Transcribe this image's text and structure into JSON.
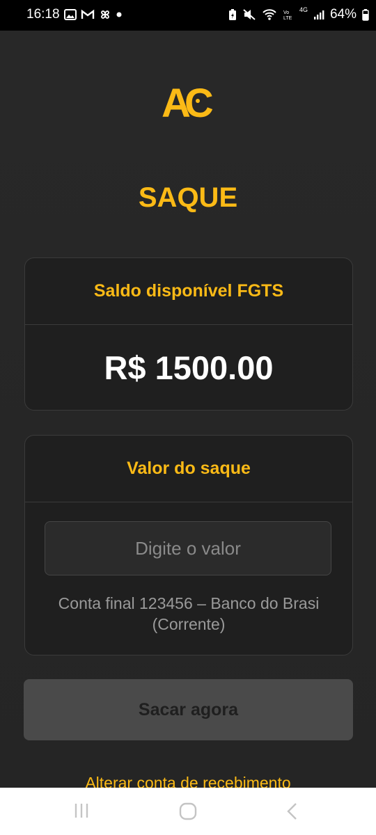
{
  "status_bar": {
    "time": "16:18",
    "network": "4G",
    "battery": "64%",
    "icons": [
      "gallery-icon",
      "gmail-icon",
      "pinwheel-icon",
      "dot-icon",
      "battery-saver-icon",
      "mute-icon",
      "wifi-icon",
      "volte-icon",
      "signal-icon",
      "battery-icon"
    ]
  },
  "logo": {
    "text": "AC",
    "color": "#FBBA16"
  },
  "page": {
    "title": "SAQUE"
  },
  "balance_card": {
    "title": "Saldo disponível FGTS",
    "value": "R$ 1500.00"
  },
  "withdraw_card": {
    "title": "Valor do saque",
    "input_placeholder": "Digite o valor",
    "input_value": "",
    "account_info": "Conta final 123456 – Banco do Brasi (Corrente)"
  },
  "actions": {
    "withdraw_label": "Sacar agora",
    "change_account_label": "Alterar conta de recebimento"
  },
  "nav_bar": {
    "buttons": [
      "recent-apps-icon",
      "home-icon",
      "back-icon"
    ]
  },
  "colors": {
    "accent": "#FBBA16",
    "background": "#272727",
    "card": "#1f1f1f",
    "button_disabled": "#4a4a4a"
  }
}
